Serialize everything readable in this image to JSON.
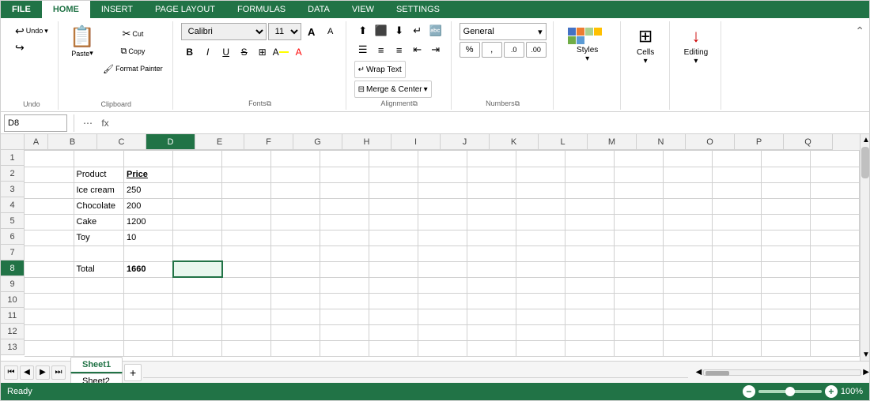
{
  "tabs": {
    "file": "FILE",
    "home": "HOME",
    "insert": "INSERT",
    "pageLayout": "PAGE LAYOUT",
    "formulas": "FORMULAS",
    "data": "DATA",
    "view": "VIEW",
    "settings": "SETTINGS"
  },
  "ribbon": {
    "undoLabel": "Undo",
    "clipboard": {
      "paste": "Paste",
      "cut": "Cut",
      "copy": "Copy",
      "formatPainter": "Format Painter"
    },
    "font": {
      "name": "Calibri",
      "size": "11",
      "bold": "B",
      "italic": "I",
      "underline": "U",
      "strikethrough": "S",
      "increaseFontSize": "A",
      "decreaseFontSize": "A"
    },
    "alignment": {
      "wrapText": "Wrap Text",
      "mergeCells": "Merge & Center"
    },
    "number": {
      "format": "General",
      "percent": "%",
      "comma": ",",
      "increaseDecimal": ".0",
      "decreaseDecimal": ".00"
    },
    "styles": {
      "label": "Styles"
    },
    "cells": {
      "label": "Cells"
    },
    "editing": {
      "label": "Editing"
    }
  },
  "formulaBar": {
    "nameBox": "D8",
    "formula": ""
  },
  "grid": {
    "columns": [
      "A",
      "B",
      "C",
      "D",
      "E",
      "F",
      "G",
      "H",
      "I",
      "J",
      "K",
      "L",
      "M",
      "N",
      "O",
      "P",
      "Q"
    ],
    "activeCol": "D",
    "activeRow": 8,
    "rows": [
      [
        null,
        null,
        null,
        null,
        null,
        null,
        null,
        null,
        null,
        null,
        null,
        null,
        null,
        null,
        null,
        null,
        null
      ],
      [
        null,
        "Product",
        "Price",
        null,
        null,
        null,
        null,
        null,
        null,
        null,
        null,
        null,
        null,
        null,
        null,
        null,
        null
      ],
      [
        null,
        "Ice cream",
        "250",
        null,
        null,
        null,
        null,
        null,
        null,
        null,
        null,
        null,
        null,
        null,
        null,
        null,
        null
      ],
      [
        null,
        "Chocolate",
        "200",
        null,
        null,
        null,
        null,
        null,
        null,
        null,
        null,
        null,
        null,
        null,
        null,
        null,
        null
      ],
      [
        null,
        "Cake",
        "1200",
        null,
        null,
        null,
        null,
        null,
        null,
        null,
        null,
        null,
        null,
        null,
        null,
        null,
        null
      ],
      [
        null,
        "Toy",
        "10",
        null,
        null,
        null,
        null,
        null,
        null,
        null,
        null,
        null,
        null,
        null,
        null,
        null,
        null
      ],
      [
        null,
        null,
        null,
        null,
        null,
        null,
        null,
        null,
        null,
        null,
        null,
        null,
        null,
        null,
        null,
        null,
        null
      ],
      [
        null,
        "Total",
        "1660",
        null,
        null,
        null,
        null,
        null,
        null,
        null,
        null,
        null,
        null,
        null,
        null,
        null,
        null
      ],
      [
        null,
        null,
        null,
        null,
        null,
        null,
        null,
        null,
        null,
        null,
        null,
        null,
        null,
        null,
        null,
        null,
        null
      ],
      [
        null,
        null,
        null,
        null,
        null,
        null,
        null,
        null,
        null,
        null,
        null,
        null,
        null,
        null,
        null,
        null,
        null
      ],
      [
        null,
        null,
        null,
        null,
        null,
        null,
        null,
        null,
        null,
        null,
        null,
        null,
        null,
        null,
        null,
        null,
        null
      ],
      [
        null,
        null,
        null,
        null,
        null,
        null,
        null,
        null,
        null,
        null,
        null,
        null,
        null,
        null,
        null,
        null,
        null
      ],
      [
        null,
        null,
        null,
        null,
        null,
        null,
        null,
        null,
        null,
        null,
        null,
        null,
        null,
        null,
        null,
        null,
        null
      ]
    ],
    "cellStyles": {
      "2-2": "bold underline",
      "2-3": "bold underline text-right",
      "3-3": "text-right",
      "4-3": "text-right",
      "5-3": "text-right",
      "6-3": "red-text",
      "8-2": "bold",
      "8-3": "text-right"
    }
  },
  "sheets": {
    "tabs": [
      "Sheet1",
      "Sheet2"
    ],
    "active": "Sheet1"
  },
  "status": {
    "ready": "Ready",
    "zoom": "100%",
    "zoomValue": 50
  }
}
